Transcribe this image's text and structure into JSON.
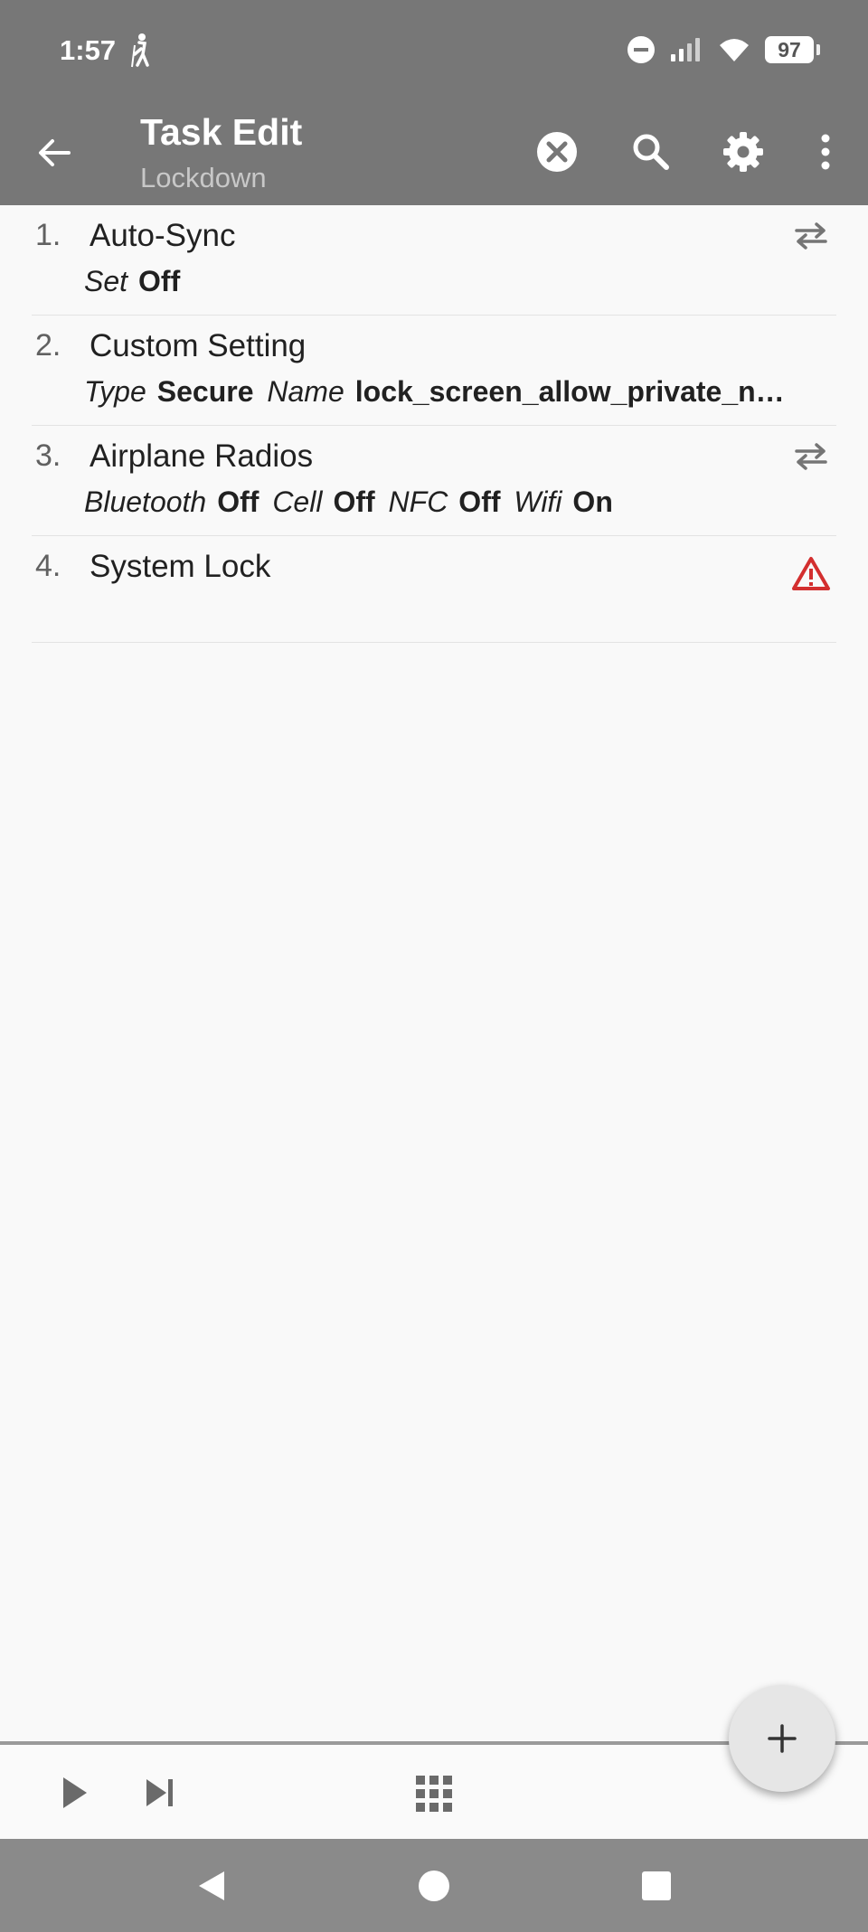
{
  "status_bar": {
    "time": "1:57",
    "battery": "97",
    "icons": [
      "hiker-icon",
      "do-not-disturb-icon",
      "signal-icon",
      "wifi-icon",
      "battery-icon"
    ]
  },
  "app_bar": {
    "title": "Task Edit",
    "subtitle": "Lockdown",
    "icons": [
      "back-arrow-icon",
      "close-circle-icon",
      "search-icon",
      "gear-icon",
      "more-vert-icon"
    ]
  },
  "actions": [
    {
      "number": "1.",
      "title": "Auto-Sync",
      "args": [
        {
          "label": "Set",
          "value": "Off"
        }
      ],
      "icon": "swap-arrows-icon"
    },
    {
      "number": "2.",
      "title": "Custom Setting",
      "args": [
        {
          "label": "Type",
          "value": "Secure"
        },
        {
          "label": "Name",
          "value": "lock_screen_allow_private_n…"
        }
      ],
      "icon": ""
    },
    {
      "number": "3.",
      "title": "Airplane Radios",
      "args": [
        {
          "label": "Bluetooth",
          "value": "Off"
        },
        {
          "label": "Cell",
          "value": "Off"
        },
        {
          "label": "NFC",
          "value": "Off"
        },
        {
          "label": "Wifi",
          "value": "On"
        }
      ],
      "icon": "swap-arrows-icon"
    },
    {
      "number": "4.",
      "title": "System Lock",
      "args": [],
      "icon": "warning-triangle-icon"
    }
  ],
  "bottom_bar": {
    "icons": [
      "play-icon",
      "step-forward-icon",
      "grid-icon",
      "plus-icon"
    ]
  },
  "nav_bar": {
    "icons": [
      "nav-back-icon",
      "nav-home-icon",
      "nav-recents-icon"
    ]
  },
  "colors": {
    "bar": "#777777",
    "background": "#f9f9f9",
    "warning": "#d32f2f"
  }
}
